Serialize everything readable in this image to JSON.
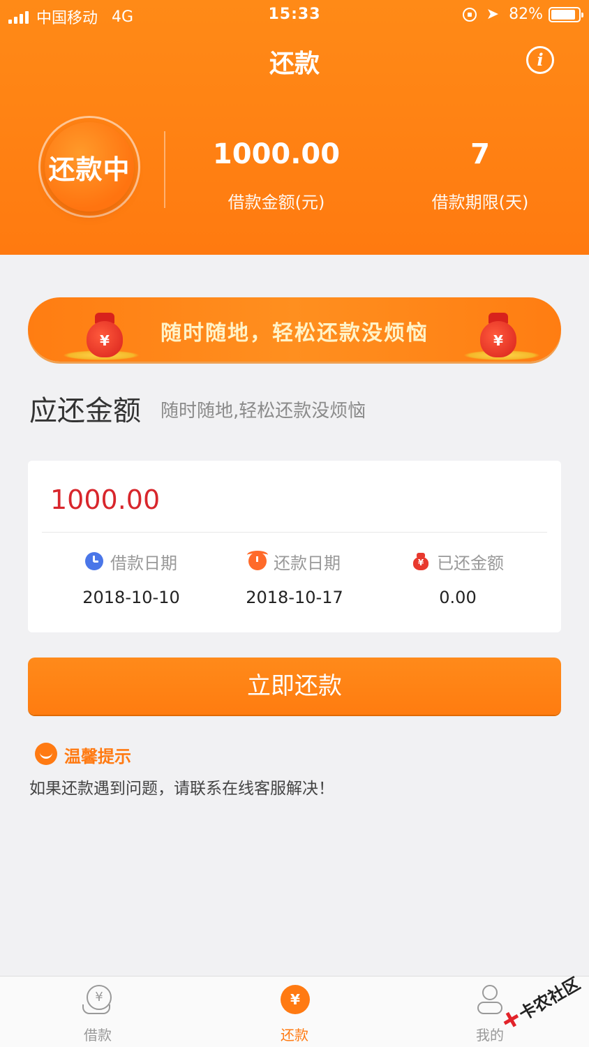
{
  "status_bar": {
    "carrier": "中国移动",
    "network": "4G",
    "time": "15:33",
    "battery": "82%",
    "location_glyph": "➤"
  },
  "header": {
    "title": "还款",
    "info_glyph": "i",
    "status_badge": "还款中",
    "amount_value": "1000.00",
    "amount_label": "借款金额(元)",
    "term_value": "7",
    "term_label": "借款期限(天)"
  },
  "banner": {
    "text": "随时随地，轻松还款没烦恼",
    "bag_glyph": "¥"
  },
  "due": {
    "title": "应还金额",
    "subtitle": "随时随地,轻松还款没烦恼"
  },
  "card": {
    "amount": "1000.00",
    "loan_date_label": "借款日期",
    "loan_date": "2018-10-10",
    "repay_date_label": "还款日期",
    "repay_date": "2018-10-17",
    "repaid_label": "已还金额",
    "repaid_amount": "0.00",
    "bag_glyph": "¥"
  },
  "pay_button": {
    "label": "立即还款"
  },
  "tips": {
    "title": "温馨提示",
    "text": "如果还款遇到问题，请联系在线客服解决！"
  },
  "tabbar": {
    "loan_label": "借款",
    "repay_label": "还款",
    "mine_label": "我的",
    "yen_glyph": "¥"
  },
  "watermark": {
    "text": "卡农社区"
  },
  "colors": {
    "brand_orange": "#ff7a12",
    "amount_red": "#d8262c",
    "background": "#f1f1f3"
  }
}
